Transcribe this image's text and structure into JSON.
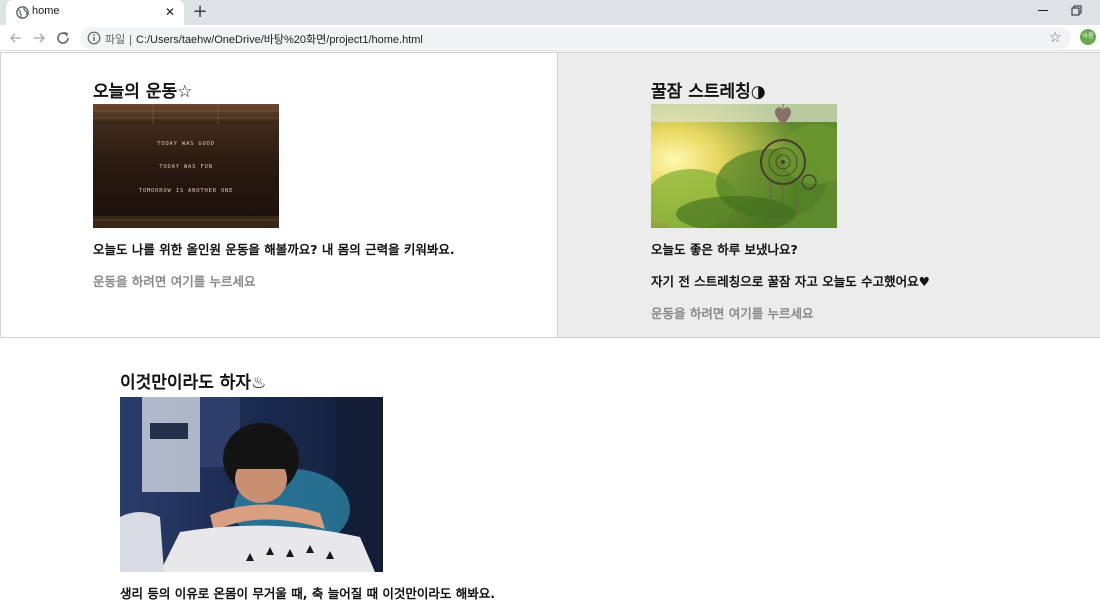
{
  "browser": {
    "tab_title": "home",
    "new_tab": "+",
    "close_tab": "✕",
    "scheme_label": "파일 |",
    "url": "C:/Users/taehw/OneDrive/바탕%20화면/project1/home.html",
    "avatar_text": "아름",
    "avatar_color": "#6aa84f"
  },
  "cards": [
    {
      "title": "오늘의 운동☆",
      "image_text_lines": [
        "TODAY WAS GOOD",
        "TODAY WAS FUN",
        "TOMORROW IS ANOTHER ONE"
      ],
      "texts": [
        "오늘도 나를 위한 올인원 운동을 해볼까요? 내 몸의 근력을 키워봐요."
      ],
      "link": "운동을 하려면 여기를 누르세요"
    },
    {
      "title": "꿀잠 스트레칭◑",
      "texts": [
        "오늘도 좋은 하루 보냈나요?",
        "자기 전 스트레칭으로 꿀잠 자고 오늘도 수고했어요♥"
      ],
      "link": "운동을 하려면 여기를 누르세요"
    },
    {
      "title": "이것만이라도 하자♨",
      "texts": [
        "생리 등의 이유로 온몸이 무거울 때, 축 늘어질 때 이것만이라도 해봐요."
      ]
    }
  ]
}
